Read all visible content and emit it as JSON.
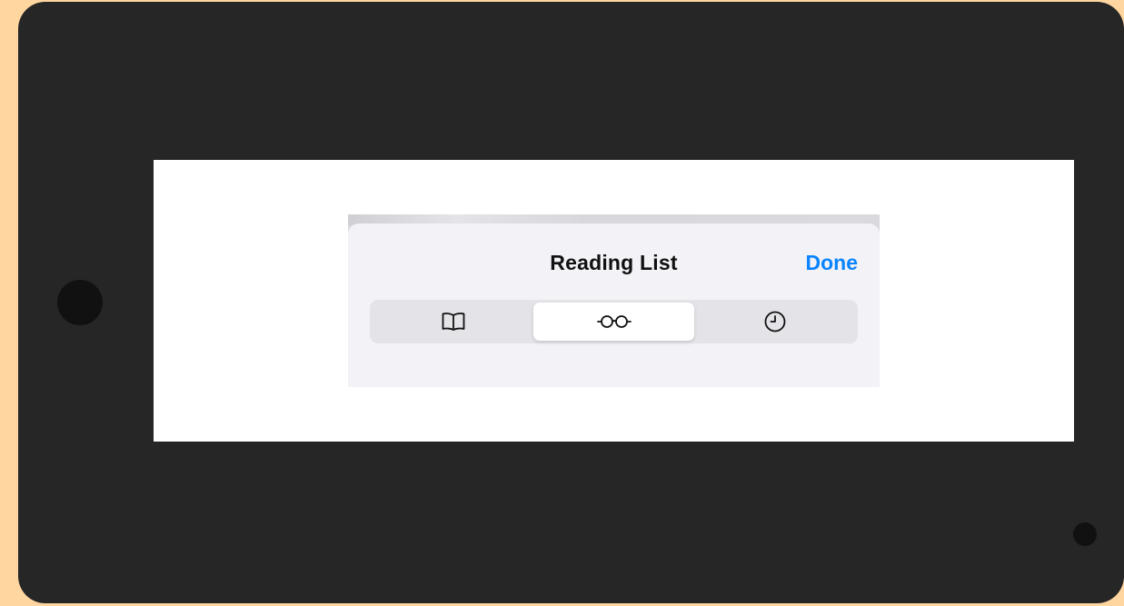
{
  "reading_list": {
    "title": "Reading List",
    "done_label": "Done",
    "accent_color": "#0a84ff",
    "segments": [
      {
        "icon": "book-icon",
        "selected": false
      },
      {
        "icon": "glasses-icon",
        "selected": true
      },
      {
        "icon": "clock-icon",
        "selected": false
      }
    ]
  }
}
